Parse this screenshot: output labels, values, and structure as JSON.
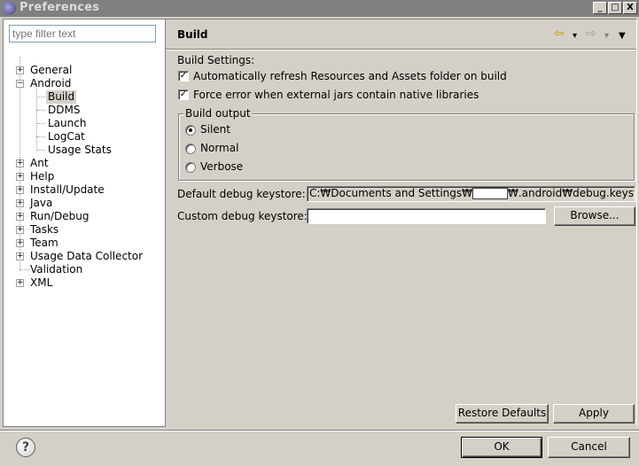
{
  "window": {
    "title": "Preferences",
    "minimize_glyph": "_",
    "maximize_glyph": "□",
    "close_glyph": "X"
  },
  "filter": {
    "placeholder": "type filter text"
  },
  "tree": {
    "items": [
      {
        "label": "General",
        "expander": "+"
      },
      {
        "label": "Android",
        "expander": "−"
      },
      {
        "label": "Build"
      },
      {
        "label": "DDMS"
      },
      {
        "label": "Launch"
      },
      {
        "label": "LogCat"
      },
      {
        "label": "Usage Stats"
      },
      {
        "label": "Ant",
        "expander": "+"
      },
      {
        "label": "Help",
        "expander": "+"
      },
      {
        "label": "Install/Update",
        "expander": "+"
      },
      {
        "label": "Java",
        "expander": "+"
      },
      {
        "label": "Run/Debug",
        "expander": "+"
      },
      {
        "label": "Tasks",
        "expander": "+"
      },
      {
        "label": "Team",
        "expander": "+"
      },
      {
        "label": "Usage Data Collector",
        "expander": "+"
      },
      {
        "label": "Validation"
      },
      {
        "label": "XML",
        "expander": "+"
      }
    ]
  },
  "page": {
    "title": "Build",
    "nav_icons": {
      "back": "⇦",
      "back_menu": "▾",
      "forward": "⇨",
      "forward_menu": "▾",
      "view_menu": "▼"
    },
    "build_settings_label": "Build Settings:",
    "auto_refresh": {
      "label": "Automatically refresh Resources and Assets folder on build",
      "checked": true,
      "mark": "✓"
    },
    "force_error": {
      "label": "Force error when external jars contain native libraries",
      "checked": true,
      "mark": "✓"
    },
    "build_output": {
      "title": "Build output",
      "options": [
        {
          "label": "Silent",
          "checked": true
        },
        {
          "label": "Normal",
          "checked": false
        },
        {
          "label": "Verbose",
          "checked": false
        }
      ]
    },
    "default_keystore": {
      "label": "Default debug keystore:",
      "value_prefix": "C:₩Documents and Settings₩",
      "value_suffix": "₩.android₩debug.keystore"
    },
    "custom_keystore": {
      "label": "Custom debug keystore:",
      "value": ""
    },
    "browse_button": "Browse...",
    "restore_defaults_button": "Restore Defaults",
    "apply_button": "Apply"
  },
  "footer": {
    "help_glyph": "?",
    "ok_button": "OK",
    "cancel_button": "Cancel"
  }
}
